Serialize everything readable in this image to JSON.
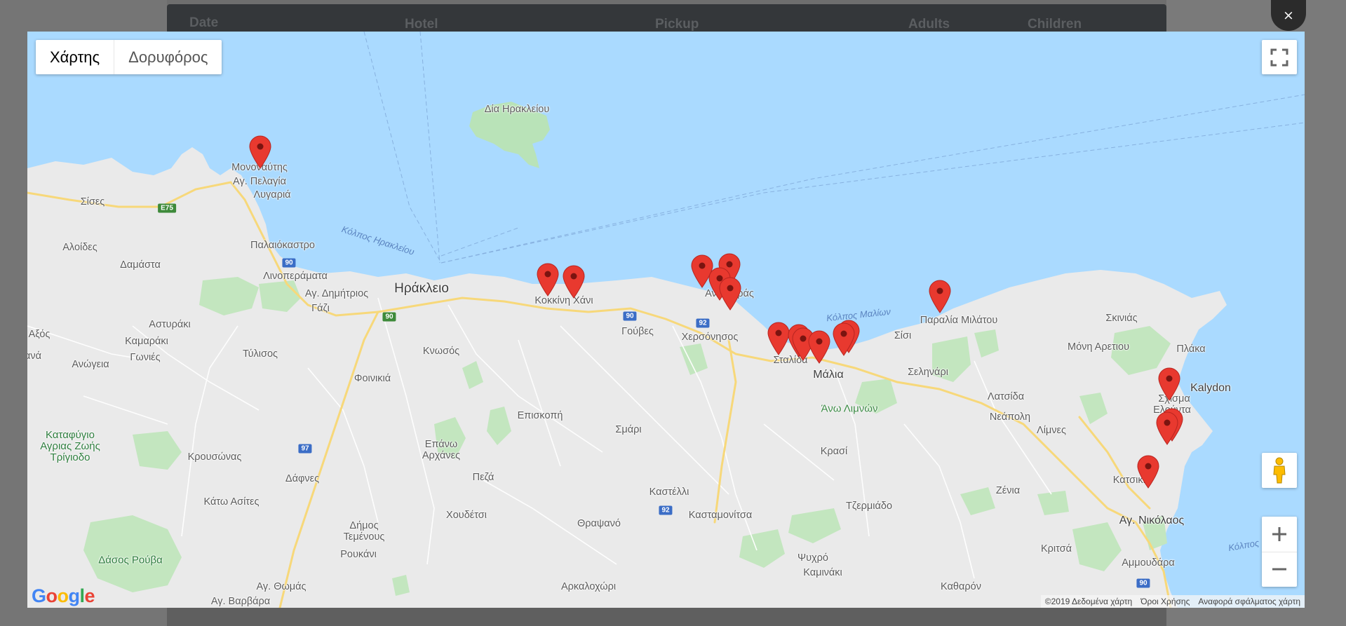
{
  "table_header": {
    "date": "Date",
    "hotel": "Hotel",
    "pickup": "Pickup",
    "adults": "Adults",
    "children": "Children"
  },
  "close_label": "×",
  "map_type": {
    "map": "Χάρτης",
    "satellite": "Δορυφόρος"
  },
  "places": {
    "dia": "Δία Ηρακλείου",
    "monovatis": "Μονοναύτης",
    "ag_pelagia": "Αγ. Πελαγία",
    "lygaria": "Λυγαριά",
    "sises": "Σίσες",
    "aloides": "Αλοίδες",
    "damasta": "Δαμάστα",
    "palaiokastro": "Παλαιόκαστρο",
    "linoperamata": "Λινοπεράματα",
    "ag_dimitrios": "Αγ. Δημήτριος",
    "gazi": "Γάζι",
    "irakleio": "Ηράκλειο",
    "kokkini_hani": "Κοκκίνη Χάνι",
    "gouves": "Γούβες",
    "anissaras": "Ανισσαράς",
    "chersonisos": "Χερσόνησος",
    "stalida": "Σταλίδα",
    "malia": "Μάλια",
    "sisi": "Σίσι",
    "milatos": "Παραλία Μιλάτου",
    "skinias": "Σκινιάς",
    "moni_aretiou": "Μόνη Αρετιου",
    "plaka": "Πλάκα",
    "kalydon": "Kalydon",
    "elounda": "Ελούντα",
    "schisma": "Σχίσμα",
    "astyraki": "Αστυράκι",
    "kamarakia": "Καμαράκι",
    "gonies": "Γωνιές",
    "anogeia": "Ανώγεια",
    "tylisos": "Τύλισος",
    "fodele": "Αξός",
    "nia": "ανά",
    "knossos": "Κνωσός",
    "foinikia": "Φοινικιά",
    "episkopi": "Επισκοπή",
    "smari": "Σμάρι",
    "krasi": "Κρασί",
    "selinari": "Σεληνάρι",
    "latsida": "Λατσίδα",
    "neapoli": "Νεάπολη",
    "limnes": "Λίμνες",
    "katsikia": "Κατσικιά",
    "ag_nikolaos": "Αγ. Νικόλαος",
    "ano_limnon": "Άνω Λιμνών",
    "krousonas": "Κρουσώνας",
    "dafnes": "Δάφνες",
    "kato_asites": "Κάτω Ασίτες",
    "epano_archanes": "Επάνω\nΑρχάνες",
    "peza": "Πεζά",
    "houdetsi": "Χουδέτσι",
    "kastelli": "Καστέλλι",
    "kastamonitsa": "Κασταμονίτσα",
    "thrapsano": "Θραψανό",
    "tzermiado": "Τζερμιάδο",
    "zenia": "Ζένια",
    "demos_temenous": "Δήμος\nΤεμένους",
    "roukani": "Ρουκάνι",
    "psychro": "Ψυχρό",
    "kaminaki": "Καμινάκι",
    "kritsa": "Κριτσά",
    "ammoudara": "Αμμουδάρα",
    "kathairon": "Καθαρόν",
    "ag_thomas": "Αγ. Θωμάς",
    "ag_varvara": "Αγ. Βαρβάρα",
    "arkalochori": "Αρκαλοχώρι",
    "rouvas": "Δάσος Ρούβα",
    "katafygio": "Καταφύγιο\nΑγριας Ζωής\nΤρίγιοδο"
  },
  "waters": {
    "kolpos_irakleiou": "Κόλπος Ηρακλείου",
    "kolpos_malion": "Κόλπος Μαλίων",
    "kolpos_mira": "Κόλπος Μιρα"
  },
  "roads": [
    "E75",
    "90",
    "90",
    "90",
    "92",
    "92",
    "97",
    "90"
  ],
  "footer": {
    "data": "©2019 Δεδομένα χάρτη",
    "terms": "Όροι Χρήσης",
    "report": "Αναφορά σφάλματος χάρτη"
  },
  "google": "Google",
  "marker_color": "#e8392f",
  "marker_count": 18
}
